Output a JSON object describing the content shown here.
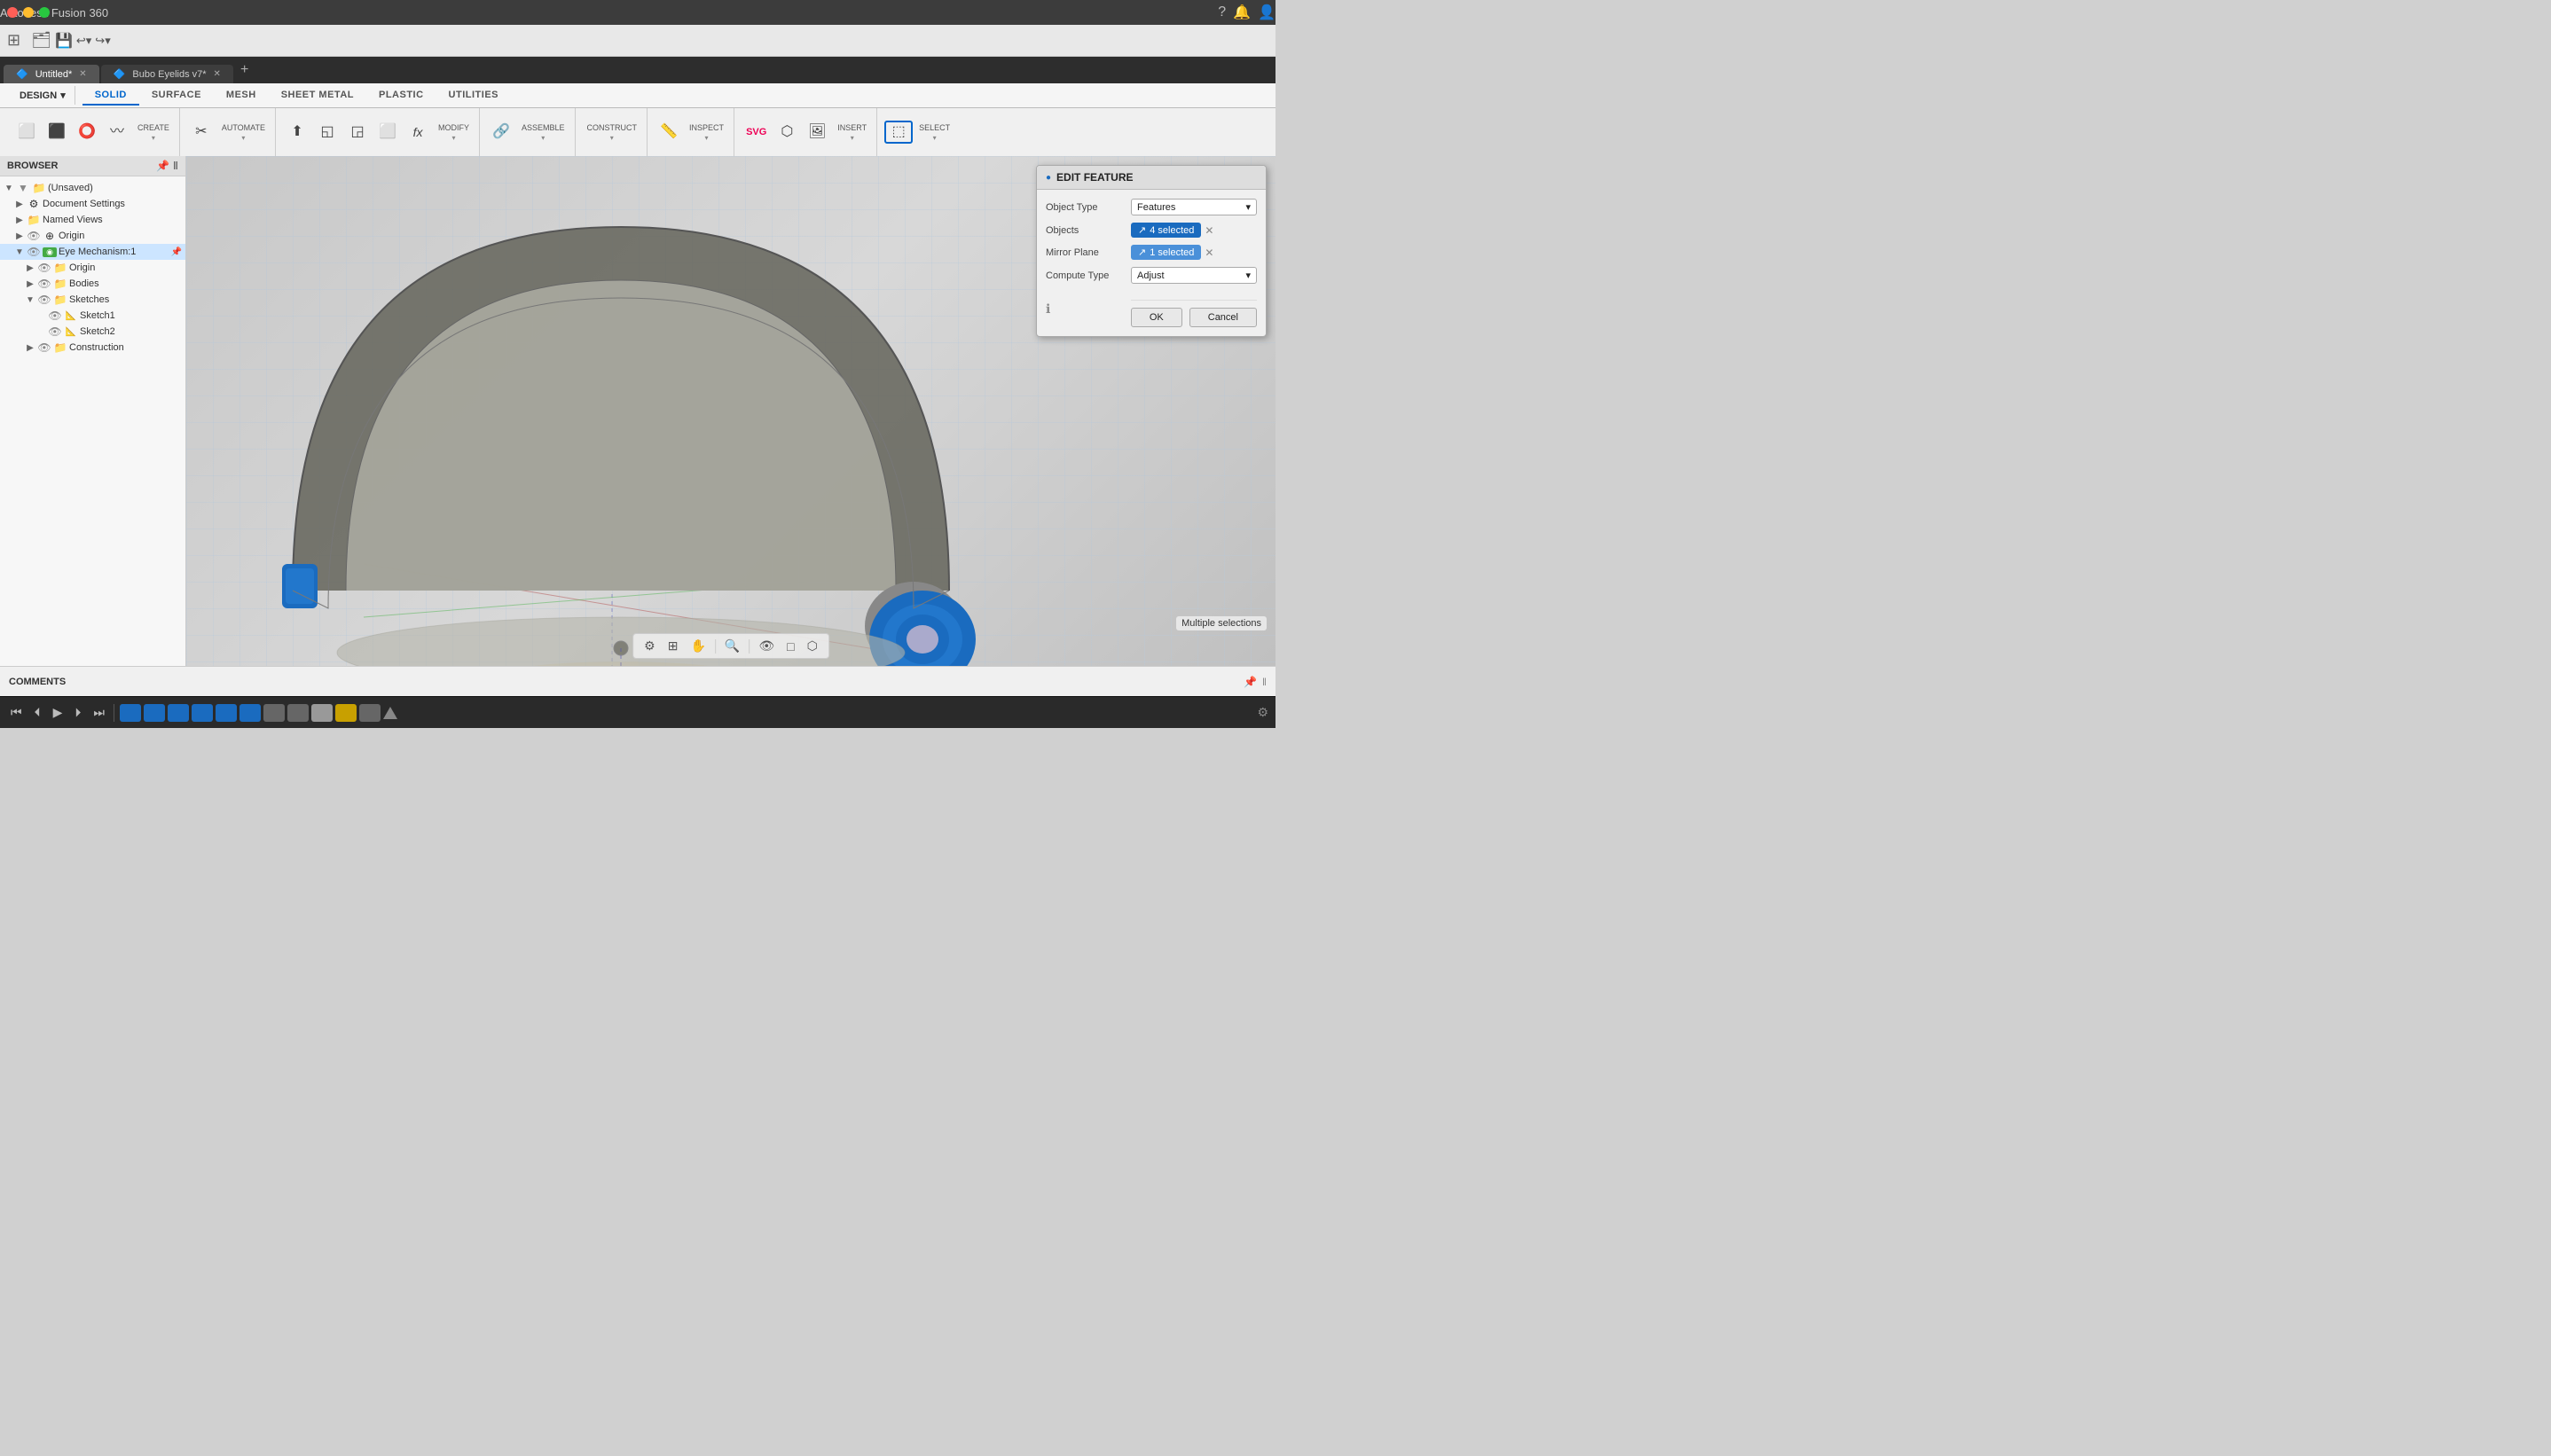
{
  "app": {
    "title": "Autodesk Fusion 360"
  },
  "toolbar_tabs": {
    "solid": "SOLID",
    "surface": "SURFACE",
    "mesh": "MESH",
    "sheet_metal": "SHEET METAL",
    "plastic": "PLASTIC",
    "utilities": "UTILITIES"
  },
  "toolbar_groups": {
    "design": "DESIGN",
    "create": "CREATE",
    "automate": "AUTOMATE",
    "modify": "MODIFY",
    "assemble": "ASSEMBLE",
    "construct": "CONSTRUCT",
    "inspect": "INSPECT",
    "insert": "INSERT",
    "select": "SELECT"
  },
  "file_tabs": [
    {
      "name": "Untitled*",
      "active": true
    },
    {
      "name": "Bubo Eyelids v7*",
      "active": false
    }
  ],
  "browser": {
    "title": "BROWSER",
    "tree": [
      {
        "level": 0,
        "expanded": true,
        "label": "(Unsaved)",
        "icon": "📁",
        "arrow": "▼"
      },
      {
        "level": 1,
        "expanded": false,
        "label": "Document Settings",
        "icon": "⚙",
        "arrow": "▶"
      },
      {
        "level": 1,
        "expanded": false,
        "label": "Named Views",
        "icon": "📁",
        "arrow": "▶"
      },
      {
        "level": 1,
        "expanded": false,
        "label": "Origin",
        "icon": "⊕",
        "arrow": "▶"
      },
      {
        "level": 1,
        "expanded": true,
        "label": "Eye Mechanism:1",
        "icon": "◉",
        "arrow": "▼",
        "special": true
      },
      {
        "level": 2,
        "expanded": false,
        "label": "Origin",
        "icon": "⊕",
        "arrow": "▶"
      },
      {
        "level": 2,
        "expanded": false,
        "label": "Bodies",
        "icon": "📁",
        "arrow": "▶"
      },
      {
        "level": 2,
        "expanded": true,
        "label": "Sketches",
        "icon": "📁",
        "arrow": "▼"
      },
      {
        "level": 3,
        "expanded": false,
        "label": "Sketch1",
        "icon": "📐",
        "arrow": ""
      },
      {
        "level": 3,
        "expanded": false,
        "label": "Sketch2",
        "icon": "📐",
        "arrow": ""
      },
      {
        "level": 2,
        "expanded": false,
        "label": "Construction",
        "icon": "📁",
        "arrow": "▶"
      }
    ]
  },
  "edit_feature": {
    "title": "EDIT FEATURE",
    "object_type_label": "Object Type",
    "object_type_value": "Features",
    "objects_label": "Objects",
    "objects_value": "4 selected",
    "mirror_plane_label": "Mirror Plane",
    "mirror_plane_value": "1 selected",
    "compute_type_label": "Compute Type",
    "compute_type_value": "Adjust",
    "ok_btn": "OK",
    "cancel_btn": "Cancel"
  },
  "status": {
    "multi_select": "Multiple selections"
  },
  "comments": {
    "label": "COMMENTS"
  },
  "timeline": {
    "frames": [
      "blue",
      "blue",
      "blue",
      "blue",
      "blue",
      "blue",
      "gray",
      "gray",
      "light",
      "yellow",
      "gray"
    ]
  }
}
